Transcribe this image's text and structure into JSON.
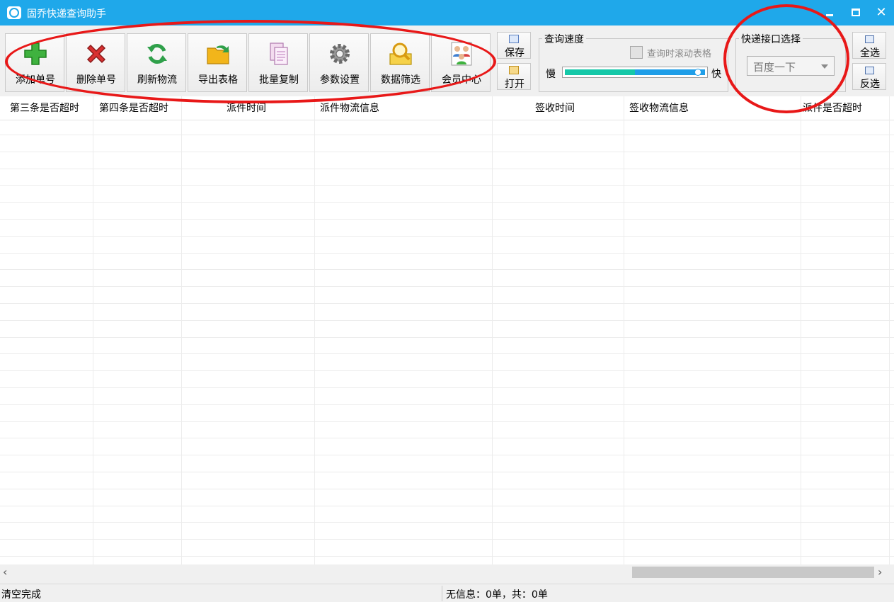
{
  "window": {
    "title": "固乔快递查询助手"
  },
  "toolbar": {
    "buttons": [
      {
        "label": "添加单号",
        "icon": "plus-icon",
        "color": "#3fb23f"
      },
      {
        "label": "删除单号",
        "icon": "delete-x-icon",
        "color": "#d83030"
      },
      {
        "label": "刷新物流",
        "icon": "refresh-icon",
        "color": "#2fa04a"
      },
      {
        "label": "导出表格",
        "icon": "folder-export-icon",
        "color": "#f2b51a"
      },
      {
        "label": "批量复制",
        "icon": "copy-pages-icon",
        "color": "#c88ac8"
      },
      {
        "label": "参数设置",
        "icon": "gear-icon",
        "color": "#8a8a8a"
      },
      {
        "label": "数据筛选",
        "icon": "magnifier-icon",
        "color": "#e8b820"
      },
      {
        "label": "会员中心",
        "icon": "users-icon",
        "color": "#3f7fd0"
      }
    ],
    "save_label": "保存",
    "open_label": "打开",
    "speed_group": {
      "title": "查询速度",
      "scroll_checkbox_label": "查询时滚动表格",
      "slow_label": "慢",
      "fast_label": "快",
      "speed_level": 1.0
    },
    "api_group": {
      "title": "快递接口选择",
      "selected": "百度一下"
    },
    "select_all_label": "全选",
    "invert_label": "反选"
  },
  "grid": {
    "columns": [
      "第三条是否超时",
      "第四条是否超时",
      "派件时间",
      "派件物流信息",
      "签收时间",
      "签收物流信息",
      "派件是否超时"
    ],
    "rows": []
  },
  "status": {
    "left": "清空完成",
    "right": "无信息：0单，共：0单"
  },
  "colors": {
    "titlebar": "#1fa8ea",
    "annotation": "#e81818"
  }
}
